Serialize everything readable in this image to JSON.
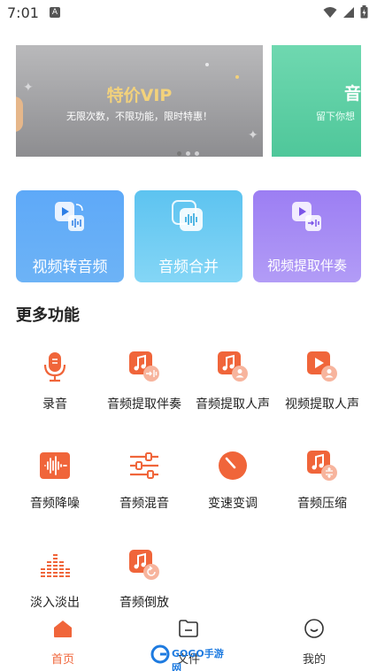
{
  "status_bar": {
    "time": "7:01",
    "notif_letter": "A"
  },
  "banner": {
    "title": "特价VIP",
    "subtitle": "无限次数，不限功能，限时特惠！",
    "second_title": "音",
    "second_subtitle": "留下你想"
  },
  "feature_cards": [
    {
      "label": "视频转音频"
    },
    {
      "label": "音频合并"
    },
    {
      "label": "视频提取伴奏"
    }
  ],
  "more_section": {
    "title": "更多功能"
  },
  "tools": [
    {
      "label": "录音",
      "icon": "microphone-icon"
    },
    {
      "label": "音频提取伴奏",
      "icon": "music-extract-accompaniment-icon"
    },
    {
      "label": "音频提取人声",
      "icon": "music-extract-vocal-icon"
    },
    {
      "label": "视频提取人声",
      "icon": "video-extract-vocal-icon"
    },
    {
      "label": "音频降噪",
      "icon": "noise-reduction-icon"
    },
    {
      "label": "音频混音",
      "icon": "mixer-sliders-icon"
    },
    {
      "label": "变速变调",
      "icon": "speed-dial-icon"
    },
    {
      "label": "音频压缩",
      "icon": "compress-icon"
    },
    {
      "label": "淡入淡出",
      "icon": "fade-bars-icon"
    },
    {
      "label": "音频倒放",
      "icon": "reverse-play-icon"
    }
  ],
  "tabbar": {
    "tabs": [
      {
        "label": "首页",
        "icon": "home-icon"
      },
      {
        "label": "文件",
        "icon": "folder-icon"
      },
      {
        "label": "我的",
        "icon": "smiley-icon"
      }
    ]
  },
  "watermark": {
    "text": "GOGO手游网"
  },
  "colors": {
    "accent": "#f0653a",
    "card_blue": "#5ea9f8",
    "card_cyan": "#5dc3f0",
    "card_purple": "#9c7ef3",
    "vip_gold": "#f3d27b"
  }
}
